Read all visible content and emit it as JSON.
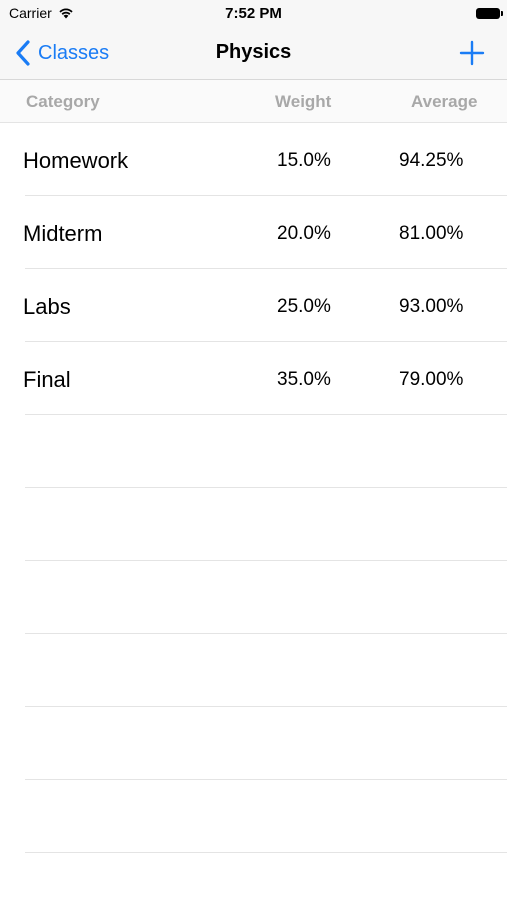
{
  "status_bar": {
    "carrier": "Carrier",
    "time": "7:52 PM",
    "wifi_icon": "wifi-icon",
    "battery_icon": "battery-icon"
  },
  "nav": {
    "back_label": "Classes",
    "back_icon": "chevron-left-icon",
    "title": "Physics",
    "add_icon": "plus-icon",
    "accent_color": "#1a7cf5"
  },
  "table": {
    "headers": {
      "category": "Category",
      "weight": "Weight",
      "average": "Average"
    },
    "rows": [
      {
        "category": "Homework",
        "weight": "15.0%",
        "average": "94.25%"
      },
      {
        "category": "Midterm",
        "weight": "20.0%",
        "average": "81.00%"
      },
      {
        "category": "Labs",
        "weight": "25.0%",
        "average": "93.00%"
      },
      {
        "category": "Final",
        "weight": "35.0%",
        "average": "79.00%"
      }
    ]
  }
}
